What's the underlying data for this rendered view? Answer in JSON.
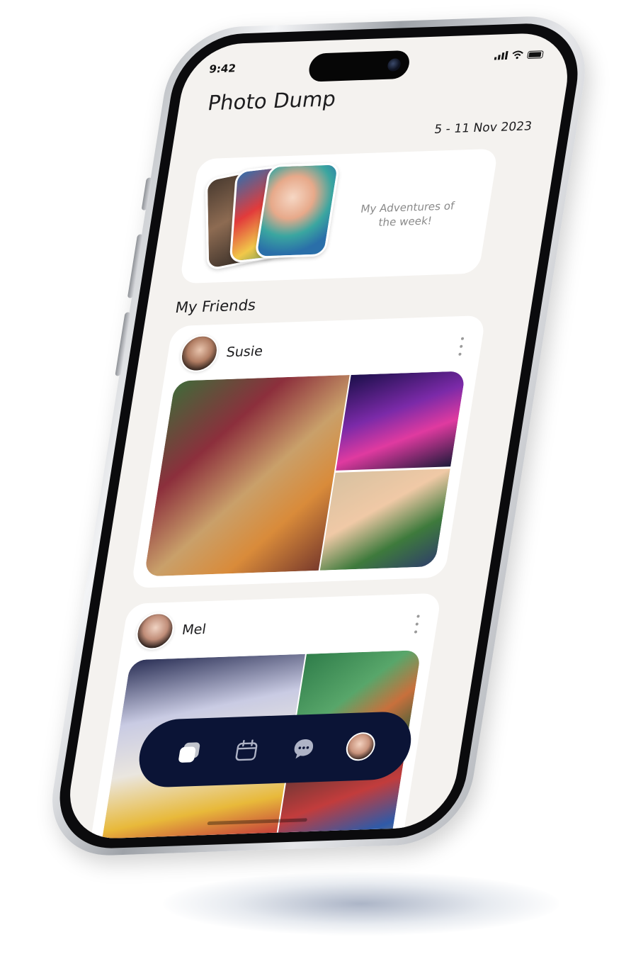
{
  "status_bar": {
    "time": "9:42"
  },
  "header": {
    "title": "Photo Dump",
    "date_range": "5 - 11 Nov 2023"
  },
  "hero": {
    "caption": "My Adventures of the week!"
  },
  "friends_section": {
    "title": "My Friends",
    "friends": [
      {
        "name": "Susie"
      },
      {
        "name": "Mel"
      }
    ]
  },
  "tab_bar": {
    "tabs": [
      {
        "icon": "stack-icon"
      },
      {
        "icon": "calendar-icon"
      },
      {
        "icon": "chat-bubble-icon"
      },
      {
        "icon": "profile-avatar"
      }
    ]
  },
  "colors": {
    "background": "#f4f2ef",
    "card": "#ffffff",
    "tab_bar": "#0b1436",
    "muted_text": "#8a8a8a"
  }
}
